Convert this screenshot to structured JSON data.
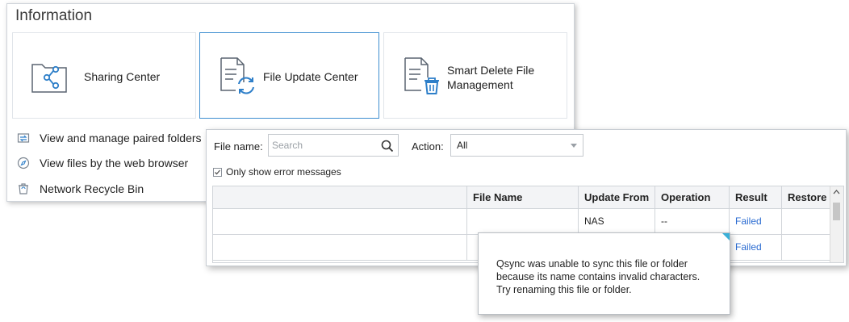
{
  "info": {
    "title": "Information",
    "cards": [
      {
        "label": "Sharing Center",
        "icon": "folder-share-icon",
        "selected": false
      },
      {
        "label": "File Update Center",
        "icon": "file-sync-icon",
        "selected": true
      },
      {
        "label": "Smart Delete File Management",
        "icon": "file-delete-icon",
        "selected": false
      }
    ],
    "links": [
      {
        "label": "View and manage paired folders",
        "icon": "paired-folders-icon"
      },
      {
        "label": "View files by the web browser",
        "icon": "compass-icon"
      },
      {
        "label": "Network Recycle Bin",
        "icon": "recycle-bin-icon"
      }
    ]
  },
  "log": {
    "filename_label": "File name:",
    "search_placeholder": "Search",
    "action_label": "Action:",
    "action_value": "All",
    "only_errors_label": "Only show error messages",
    "only_errors_checked": true,
    "columns": [
      "",
      "File Name",
      "Update From",
      "Operation",
      "Result",
      "Restore"
    ],
    "rows": [
      {
        "name": "",
        "file_name": "",
        "update_from": "NAS",
        "operation": "--",
        "result": "Failed",
        "restore": ""
      },
      {
        "name": "",
        "file_name": "",
        "update_from": "",
        "operation": "",
        "result": "Failed",
        "restore": ""
      }
    ]
  },
  "tooltip": {
    "text": "Qsync was unable to sync this file or folder because its name contains invalid characters. Try renaming this file or folder."
  },
  "colors": {
    "accent": "#3e8ed0",
    "link": "#2a6bd1",
    "icon_blue": "#2e7fc9"
  }
}
